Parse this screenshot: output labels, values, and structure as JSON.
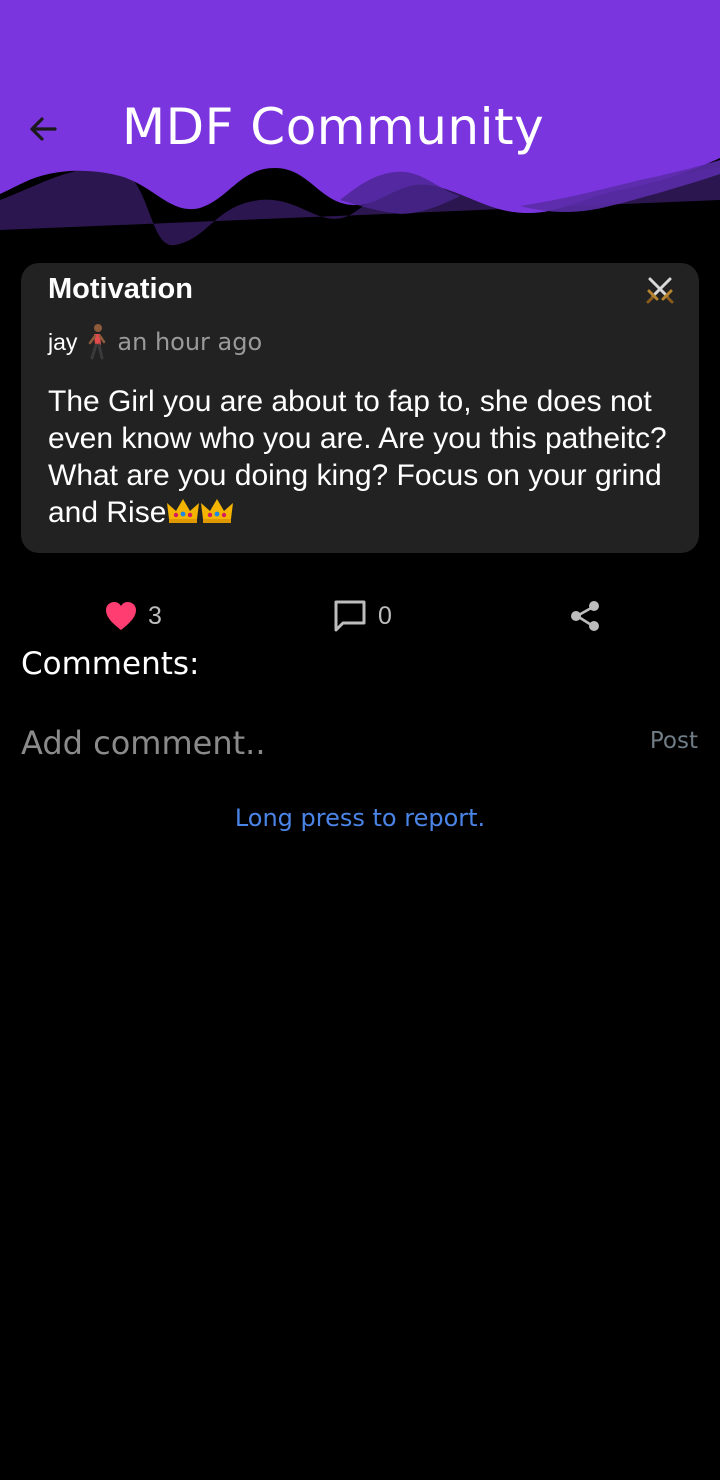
{
  "header": {
    "title": "MDF Community",
    "back_icon": "arrow-left-icon",
    "accent_color": "#7A35DE"
  },
  "post": {
    "category": "Motivation",
    "category_icon": "crossed-swords-icon",
    "author": "jay",
    "author_icon": "person-walking-icon",
    "time": "an hour ago",
    "body": "The Girl you are about to fap to, she does not even know who you are. Are you this patheitc? What are you doing king? Focus on your grind and Rise",
    "body_icons": [
      "crown-icon",
      "crown-icon"
    ]
  },
  "actions": {
    "likes": "3",
    "like_icon": "heart-icon",
    "like_color": "#FF3D71",
    "comments": "0",
    "comment_icon": "comment-icon",
    "share_icon": "share-icon"
  },
  "comments": {
    "heading": "Comments:",
    "input_placeholder": "Add comment..",
    "post_label": "Post"
  },
  "footer": {
    "report_hint": "Long press to report.",
    "report_color": "#4A84E6"
  }
}
